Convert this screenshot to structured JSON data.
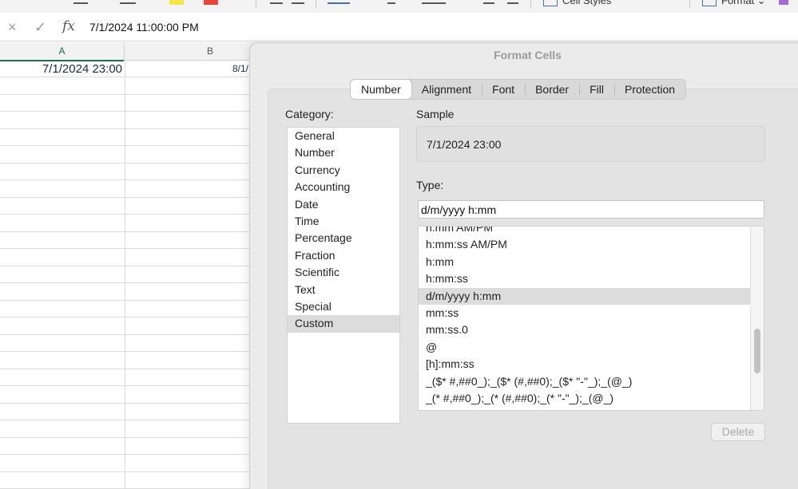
{
  "ribbon": {
    "cell_styles_label": "Cell Styles",
    "format_label": "Format"
  },
  "formula_bar": {
    "cancel_icon": "×",
    "enter_icon": "✓",
    "fx_label": "fx",
    "value": "7/1/2024  11:00:00 PM"
  },
  "grid": {
    "columns": [
      "A",
      "B"
    ],
    "cells": {
      "A1": "7/1/2024 23:00",
      "B1": "8/1/"
    }
  },
  "dialog": {
    "title": "Format Cells",
    "tabs": [
      "Number",
      "Alignment",
      "Font",
      "Border",
      "Fill",
      "Protection"
    ],
    "active_tab": "Number",
    "category_label": "Category:",
    "categories": [
      "General",
      "Number",
      "Currency",
      "Accounting",
      "Date",
      "Time",
      "Percentage",
      "Fraction",
      "Scientific",
      "Text",
      "Special",
      "Custom"
    ],
    "selected_category": "Custom",
    "sample_label": "Sample",
    "sample_value": "7/1/2024 23:00",
    "type_label": "Type:",
    "type_value": "d/m/yyyy h:mm",
    "type_list": [
      "h:mm AM/PM",
      "h:mm:ss AM/PM",
      "h:mm",
      "h:mm:ss",
      "d/m/yyyy h:mm",
      "mm:ss",
      "mm:ss.0",
      "@",
      "[h]:mm:ss",
      "_($* #,##0_);_($* (#,##0);_($* \"-\"_);_(@_)",
      "_(* #,##0_);_(* (#,##0);_(* \"-\"_);_(@_)"
    ],
    "selected_type": "d/m/yyyy h:mm",
    "delete_label": "Delete"
  }
}
